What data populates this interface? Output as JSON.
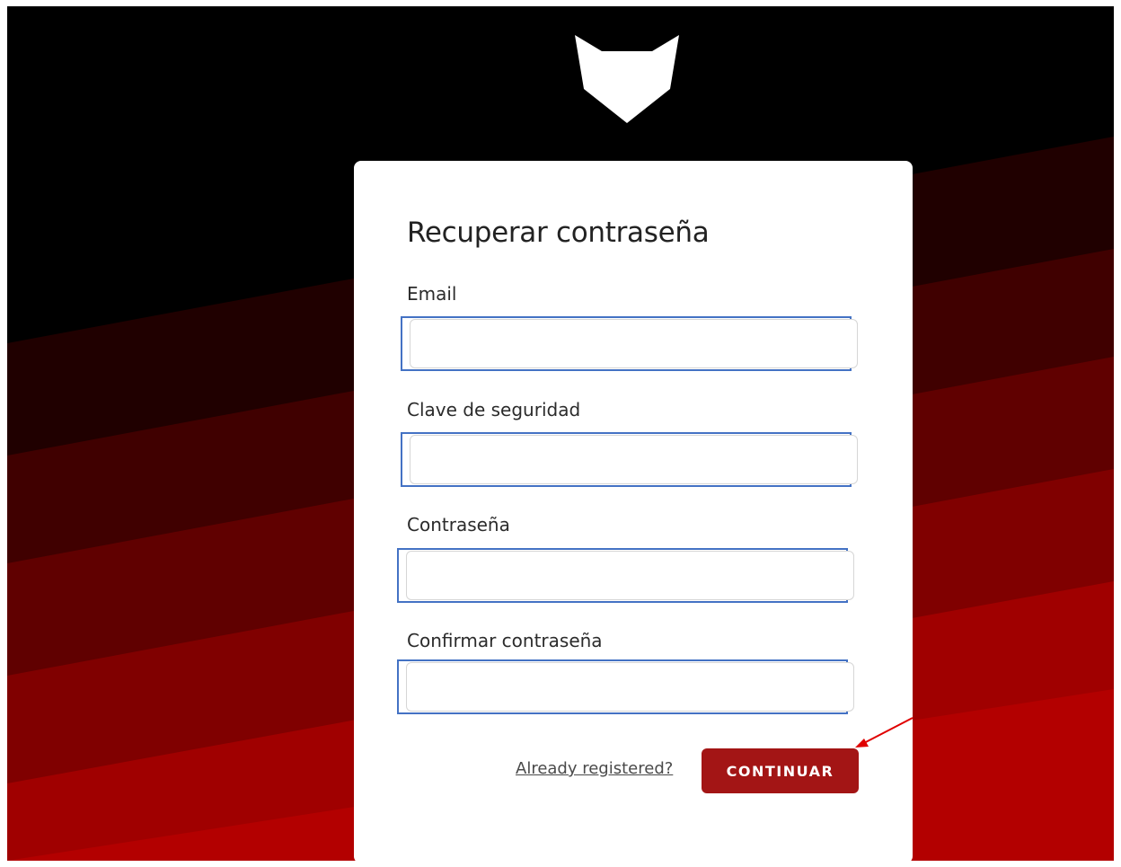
{
  "form": {
    "title": "Recuperar contraseña",
    "fields": [
      {
        "label": "Email",
        "value": "",
        "placeholder": ""
      },
      {
        "label": "Clave de seguridad",
        "value": "",
        "placeholder": ""
      },
      {
        "label": "Contraseña",
        "value": "",
        "placeholder": ""
      },
      {
        "label": "Confirmar contraseña",
        "value": "",
        "placeholder": ""
      }
    ],
    "link_label": "Already registered?",
    "submit_label": "CONTINUAR"
  },
  "icons": {
    "logo": "fox-head-icon",
    "annotation": "red-arrow-icon"
  },
  "colors": {
    "button": "#a31515",
    "highlight_border": "#4472c4",
    "background_stripes": [
      "#000000",
      "#200000",
      "#400000",
      "#600000",
      "#800000",
      "#a00000",
      "#b30000"
    ],
    "annotation_arrow": "#e00000"
  }
}
